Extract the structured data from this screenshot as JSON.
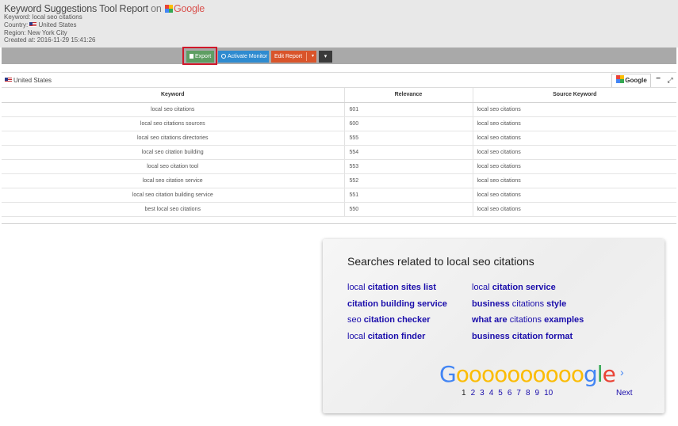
{
  "report": {
    "title": "Keyword Suggestions Tool Report",
    "on_label": "on",
    "engine_label": "Google",
    "keyword_line": "Keyword: local seo citations",
    "country_label": "Country:",
    "country_value": "United States",
    "region_line": "Region: New York City",
    "created_line": "Created at: 2016-11-29 15:41:26"
  },
  "toolbar": {
    "export_label": "Export",
    "activate_monitor_label": "Activate Monitor",
    "edit_report_label": "Edit Report",
    "edit_caret": "▾",
    "more_caret": "▾",
    "highlight_color": "#d0182a"
  },
  "region_bar": {
    "label": "United States",
    "tab_label": "Google",
    "minimize_symbol": "−",
    "expand_symbol": "⤢"
  },
  "table": {
    "columns": [
      "Keyword",
      "Relevance",
      "Source Keyword"
    ],
    "rows": [
      {
        "keyword": "local seo citations",
        "relevance": "601",
        "source": "local seo citations"
      },
      {
        "keyword": "local seo citations sources",
        "relevance": "600",
        "source": "local seo citations"
      },
      {
        "keyword": "local seo citations directories",
        "relevance": "555",
        "source": "local seo citations"
      },
      {
        "keyword": "local seo citation building",
        "relevance": "554",
        "source": "local seo citations"
      },
      {
        "keyword": "local seo citation tool",
        "relevance": "553",
        "source": "local seo citations"
      },
      {
        "keyword": "local seo citation service",
        "relevance": "552",
        "source": "local seo citations"
      },
      {
        "keyword": "local seo citation building service",
        "relevance": "551",
        "source": "local seo citations"
      },
      {
        "keyword": "best local seo citations",
        "relevance": "550",
        "source": "local seo citations"
      }
    ]
  },
  "related": {
    "title": "Searches related to local seo citations",
    "left": [
      {
        "plain": "local ",
        "bold": "citation sites list"
      },
      {
        "plain": "",
        "bold": "citation building service"
      },
      {
        "plain": "seo ",
        "bold": "citation checker"
      },
      {
        "plain": "local ",
        "bold": "citation finder"
      }
    ],
    "right": [
      {
        "plain": "local ",
        "bold": "citation service"
      },
      {
        "bold_pre": "business",
        "plain": " citations ",
        "bold": "style"
      },
      {
        "bold_pre": "what are",
        "plain": " citations ",
        "bold": "examples"
      },
      {
        "plain": "",
        "bold": "business citation format"
      }
    ],
    "logo": {
      "G": "G",
      "os": "oooooooooo",
      "g": "g",
      "l": "l",
      "e": "e"
    },
    "pages": [
      "1",
      "2",
      "3",
      "4",
      "5",
      "6",
      "7",
      "8",
      "9",
      "10"
    ],
    "current_page": "1",
    "next_chevron": "›",
    "next_label": "Next",
    "colors": {
      "blue": "#4285f4",
      "red": "#ea4335",
      "yellow": "#fbbc05",
      "green": "#34a853",
      "link": "#1a0dab"
    }
  }
}
